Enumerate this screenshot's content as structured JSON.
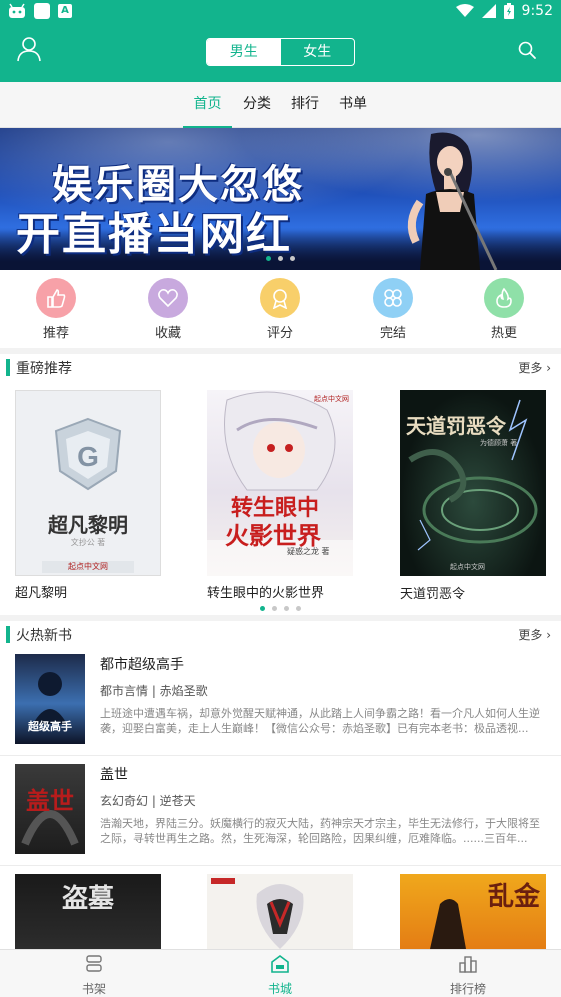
{
  "status_bar": {
    "time": "9:52",
    "app_badge": "A"
  },
  "header": {
    "gender_tabs": [
      {
        "label": "男生",
        "active": true
      },
      {
        "label": "女生",
        "active": false
      }
    ]
  },
  "tabs": [
    {
      "label": "首页",
      "active": true
    },
    {
      "label": "分类",
      "active": false
    },
    {
      "label": "排行",
      "active": false
    },
    {
      "label": "书单",
      "active": false
    }
  ],
  "banner": {
    "line1": "娱乐圈大忽悠",
    "line2": "开直播当网红",
    "page_count": 3,
    "active_page": 1
  },
  "quick_links": [
    {
      "label": "推荐",
      "color": "#f7a1a8",
      "icon": "thumbs-up-icon"
    },
    {
      "label": "收藏",
      "color": "#c8a9de",
      "icon": "heart-icon"
    },
    {
      "label": "评分",
      "color": "#f8cf6a",
      "icon": "award-icon"
    },
    {
      "label": "完结",
      "color": "#8fd0f5",
      "icon": "clover-icon"
    },
    {
      "label": "热更",
      "color": "#8fe0a8",
      "icon": "flame-icon"
    }
  ],
  "featured": {
    "title": "重磅推荐",
    "more": "更多",
    "page_count": 4,
    "active_page": 1,
    "books": [
      {
        "title": "超凡黎明",
        "cover_text": "超凡黎明",
        "cover_author": "文抄公 著",
        "cover_publisher": "起点中文网"
      },
      {
        "title": "转生眼中的火影世界",
        "cover_text": "转生眼中",
        "cover_text2": "火影世界",
        "cover_author": "疑惑之龙 著",
        "cover_publisher": "起点中文网"
      },
      {
        "title": "天道罚恶令",
        "cover_text": "天道罚恶令",
        "cover_author": "为德顾萧 著",
        "cover_publisher": "起点中文网"
      }
    ]
  },
  "new_books": {
    "title": "火热新书",
    "more": "更多",
    "books": [
      {
        "title": "都市超级高手",
        "meta": "都市言情 | 赤焰圣歌",
        "desc": "上班途中遭遇车祸，却意外觉醒天赋神通，从此踏上人间争霸之路！看一介凡人如何人生逆袭，迎娶白富美，走上人生巅峰！【微信公众号：赤焰圣歌】已有完本老书：极品透视...",
        "cover_text": "超级高手"
      },
      {
        "title": "盖世",
        "meta": "玄幻奇幻 | 逆苍天",
        "desc": "浩瀚天地，界陆三分。妖魔横行的寂灭大陆，药神宗天才宗主，毕生无法修行，于大限将至之际，寻转世再生之路。然，生死海深，轮回路险，因果纠缠，厄难降临。......三百年...",
        "cover_text": "盖世"
      }
    ],
    "bottom_covers": [
      {
        "cover_text": "盗墓"
      },
      {
        "cover_text": ""
      },
      {
        "cover_text": "乱金"
      }
    ]
  },
  "bottom_nav": [
    {
      "label": "书架",
      "active": false
    },
    {
      "label": "书城",
      "active": true
    },
    {
      "label": "排行榜",
      "active": false
    }
  ]
}
